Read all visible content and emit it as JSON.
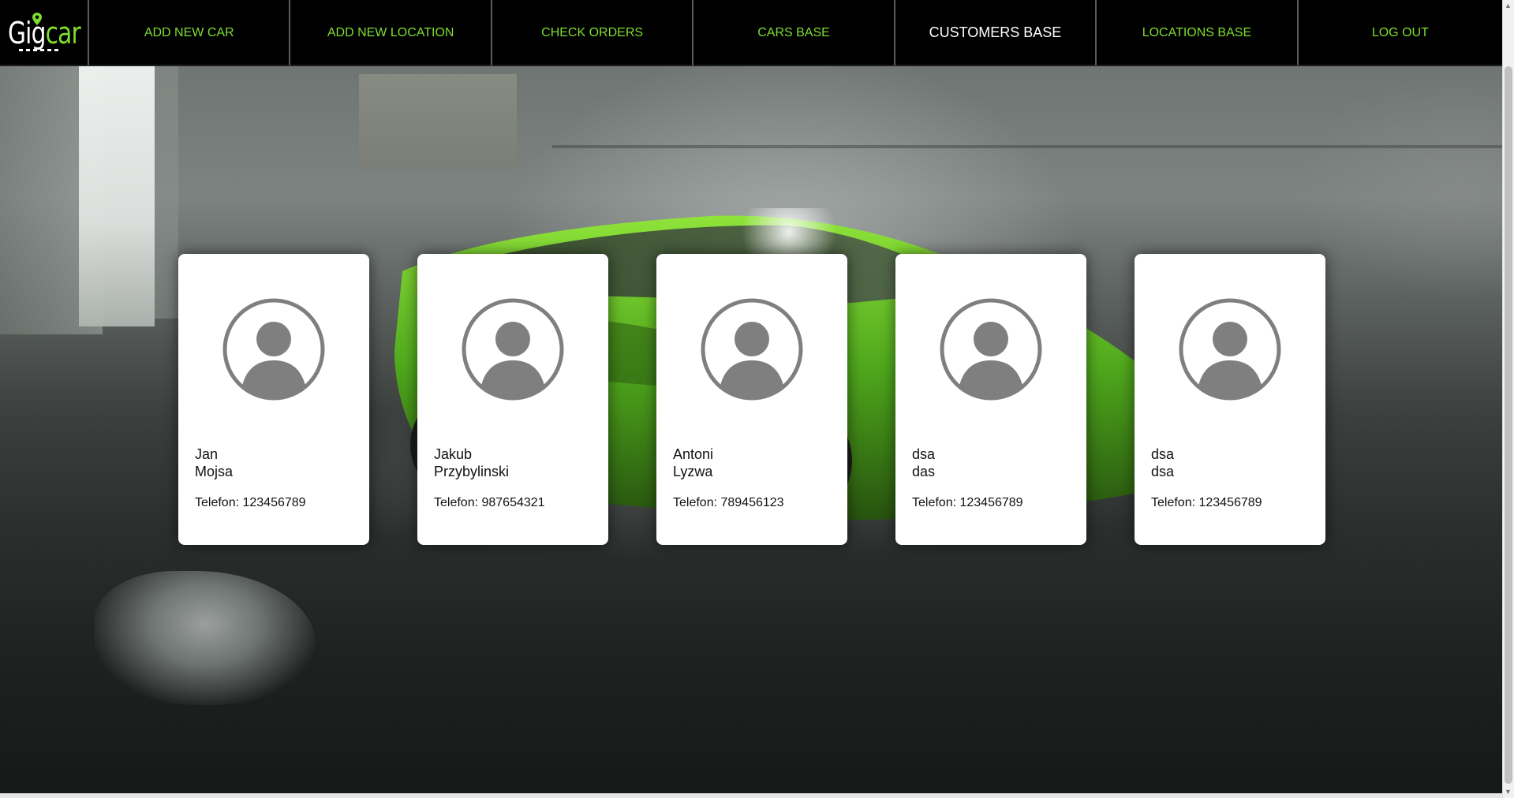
{
  "app": {
    "logo_text_a": "Gig",
    "logo_text_b": "car",
    "accent_color": "#7fdd2f"
  },
  "nav": {
    "items": [
      {
        "label": "ADD NEW CAR"
      },
      {
        "label": "ADD NEW LOCATION"
      },
      {
        "label": "CHECK ORDERS"
      },
      {
        "label": "CARS BASE"
      },
      {
        "label": "CUSTOMERS BASE",
        "active": true
      },
      {
        "label": "LOCATIONS BASE"
      },
      {
        "label": "LOG OUT"
      }
    ]
  },
  "customers": [
    {
      "first_name": "Jan",
      "last_name": "Mojsa",
      "phone": "Telefon: 123456789"
    },
    {
      "first_name": "Jakub",
      "last_name": "Przybylinski",
      "phone": "Telefon: 987654321"
    },
    {
      "first_name": "Antoni",
      "last_name": "Lyzwa",
      "phone": "Telefon: 789456123"
    },
    {
      "first_name": "dsa",
      "last_name": "das",
      "phone": "Telefon: 123456789"
    },
    {
      "first_name": "dsa",
      "last_name": "dsa",
      "phone": "Telefon: 123456789"
    }
  ],
  "icons": {
    "avatar": "user-avatar-icon",
    "logo_pin": "location-pin-icon"
  }
}
